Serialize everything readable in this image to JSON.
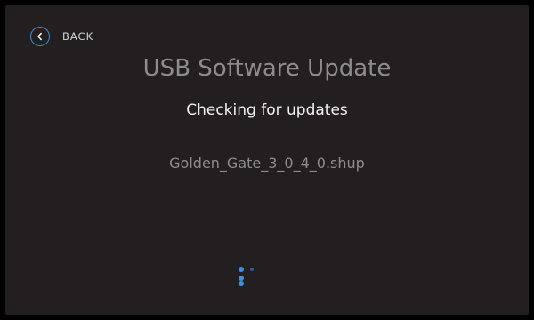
{
  "back": {
    "label": "BACK",
    "icon": "chevron-left-icon"
  },
  "title": "USB Software Update",
  "status": "Checking for updates",
  "filename": "Golden_Gate_3_0_4_0.shup",
  "spinner": {
    "icon": "loading-spinner-icon"
  },
  "colors": {
    "background": "#231f20",
    "accent": "#3d8fe0",
    "title": "#8e8c8d",
    "status": "#f2f2f2"
  }
}
